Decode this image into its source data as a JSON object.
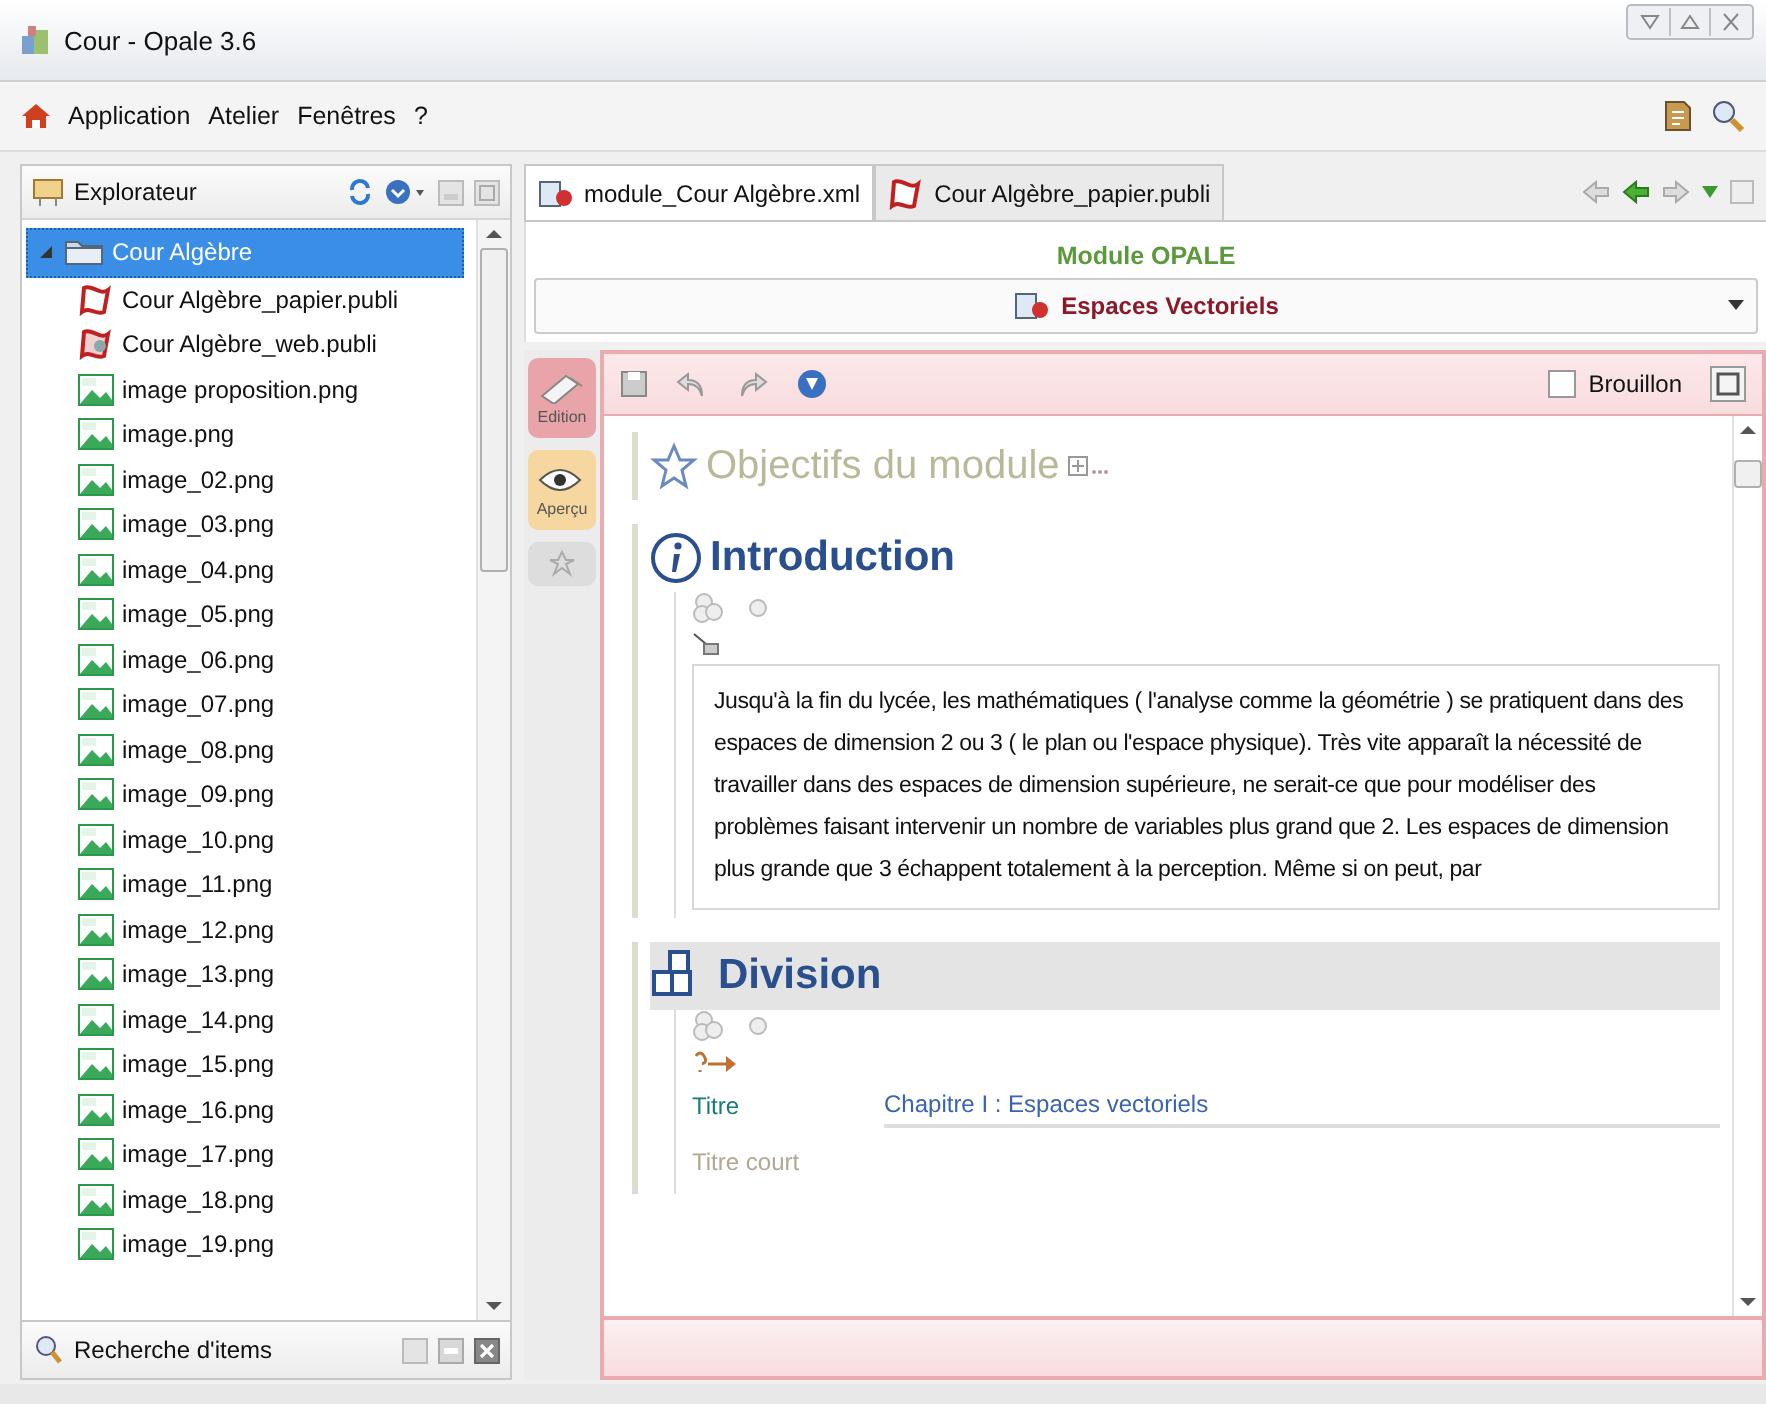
{
  "window": {
    "title": "Cour - Opale 3.6"
  },
  "menu": [
    {
      "label": "Application"
    },
    {
      "label": "Atelier"
    },
    {
      "label": "Fenêtres"
    },
    {
      "label": "?"
    }
  ],
  "explorer": {
    "title": "Explorateur",
    "tree": [
      {
        "label": "Cour Algèbre",
        "kind": "folder",
        "selected": true,
        "expanded": true,
        "children": [
          {
            "label": "Cour Algèbre_papier.publi",
            "kind": "publi",
            "selected": false
          },
          {
            "label": "Cour Algèbre_web.publi",
            "kind": "web",
            "selected": false
          },
          {
            "label": "image proposition.png",
            "kind": "png",
            "selected": false
          },
          {
            "label": "image.png",
            "kind": "png",
            "selected": false
          },
          {
            "label": "image_02.png",
            "kind": "png",
            "selected": false
          },
          {
            "label": "image_03.png",
            "kind": "png",
            "selected": false
          },
          {
            "label": "image_04.png",
            "kind": "png",
            "selected": false
          },
          {
            "label": "image_05.png",
            "kind": "png",
            "selected": false
          },
          {
            "label": "image_06.png",
            "kind": "png",
            "selected": false
          },
          {
            "label": "image_07.png",
            "kind": "png",
            "selected": false
          },
          {
            "label": "image_08.png",
            "kind": "png",
            "selected": false
          },
          {
            "label": "image_09.png",
            "kind": "png",
            "selected": false
          },
          {
            "label": "image_10.png",
            "kind": "png",
            "selected": false
          },
          {
            "label": "image_11.png",
            "kind": "png",
            "selected": false
          },
          {
            "label": "image_12.png",
            "kind": "png",
            "selected": false
          },
          {
            "label": "image_13.png",
            "kind": "png",
            "selected": false
          },
          {
            "label": "image_14.png",
            "kind": "png",
            "selected": false
          },
          {
            "label": "image_15.png",
            "kind": "png",
            "selected": false
          },
          {
            "label": "image_16.png",
            "kind": "png",
            "selected": false
          },
          {
            "label": "image_17.png",
            "kind": "png",
            "selected": false
          },
          {
            "label": "image_18.png",
            "kind": "png",
            "selected": false
          },
          {
            "label": "image_19.png",
            "kind": "png",
            "selected": false
          }
        ]
      }
    ]
  },
  "search_panel": {
    "title": "Recherche d'items"
  },
  "tabs": [
    {
      "label": "module_Cour Algèbre.xml",
      "kind": "module",
      "selected": true
    },
    {
      "label": "Cour Algèbre_papier.publi",
      "kind": "publi",
      "selected": false
    }
  ],
  "module_header": {
    "title": "Module OPALE",
    "item": "Espaces Vectoriels"
  },
  "side_tabs": [
    {
      "label": "Edition",
      "kind": "edit",
      "selected": true
    },
    {
      "label": "Aperçu",
      "kind": "preview",
      "selected": false
    }
  ],
  "draft": {
    "label": "Brouillon",
    "checked": false
  },
  "sections": [
    {
      "kind": "objectives",
      "title": "Objectifs du module"
    },
    {
      "kind": "intro",
      "title": "Introduction",
      "text": "Jusqu'à la fin du lycée, les mathématiques ( l'analyse comme la géométrie ) se pratiquent dans des espaces de dimension 2 ou 3 ( le plan ou l'espace physique). Très vite apparaît la nécessité de travailler dans des espaces de dimension supérieure, ne serait-ce que pour modéliser des problèmes faisant intervenir un nombre de variables plus grand que 2. Les espaces de dimension plus grande que 3 échappent totalement à la perception. Même si on peut, par"
    },
    {
      "kind": "division",
      "title": "Division",
      "fields": [
        {
          "label": "Titre",
          "value": "Chapitre I : Espaces vectoriels"
        },
        {
          "label": "Titre court"
        }
      ]
    }
  ]
}
